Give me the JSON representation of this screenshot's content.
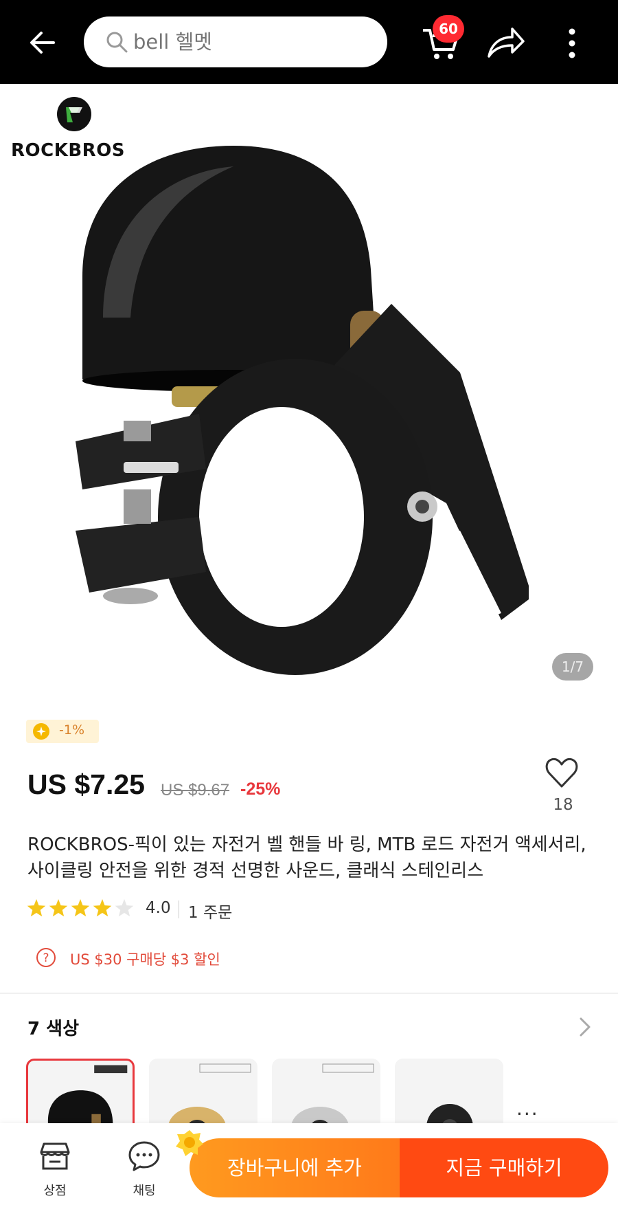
{
  "search": {
    "placeholder": "bell 헬멧"
  },
  "header": {
    "cart_count": "60"
  },
  "gallery": {
    "brand": "ROCKBROS",
    "counter": "1/7"
  },
  "coin_tag": {
    "label": "-1%"
  },
  "pricing": {
    "price": "US $7.25",
    "original_price": "US $9.67",
    "discount": "-25%"
  },
  "wishlist": {
    "count": "18"
  },
  "product": {
    "title": "ROCKBROS-픽이 있는 자전거 벨 핸들 바 링, MTB 로드 자전거 액세서리, 사이클링 안전을 위한 경적 선명한 사운드, 클래식 스테인리스",
    "rating": 4.0,
    "rating_label": "4.0",
    "orders": "1 주문"
  },
  "promo": {
    "text": "US $30 구매당 $3 할인"
  },
  "variants": {
    "title": "7 색상",
    "items": [
      {
        "color": "#111111",
        "selected": true
      },
      {
        "color": "#d8b36a",
        "selected": false
      },
      {
        "color": "#c9c9c9",
        "selected": false
      },
      {
        "color": "#222222",
        "selected": false
      }
    ],
    "more": "..."
  },
  "bottom_bar": {
    "store_label": "상점",
    "chat_label": "채팅",
    "add_to_cart": "장바구니에 추가",
    "buy_now": "지금 구매하기"
  },
  "colors": {
    "accent": "#ff4a12",
    "price_red": "#e8383d",
    "star": "#f5c518"
  }
}
